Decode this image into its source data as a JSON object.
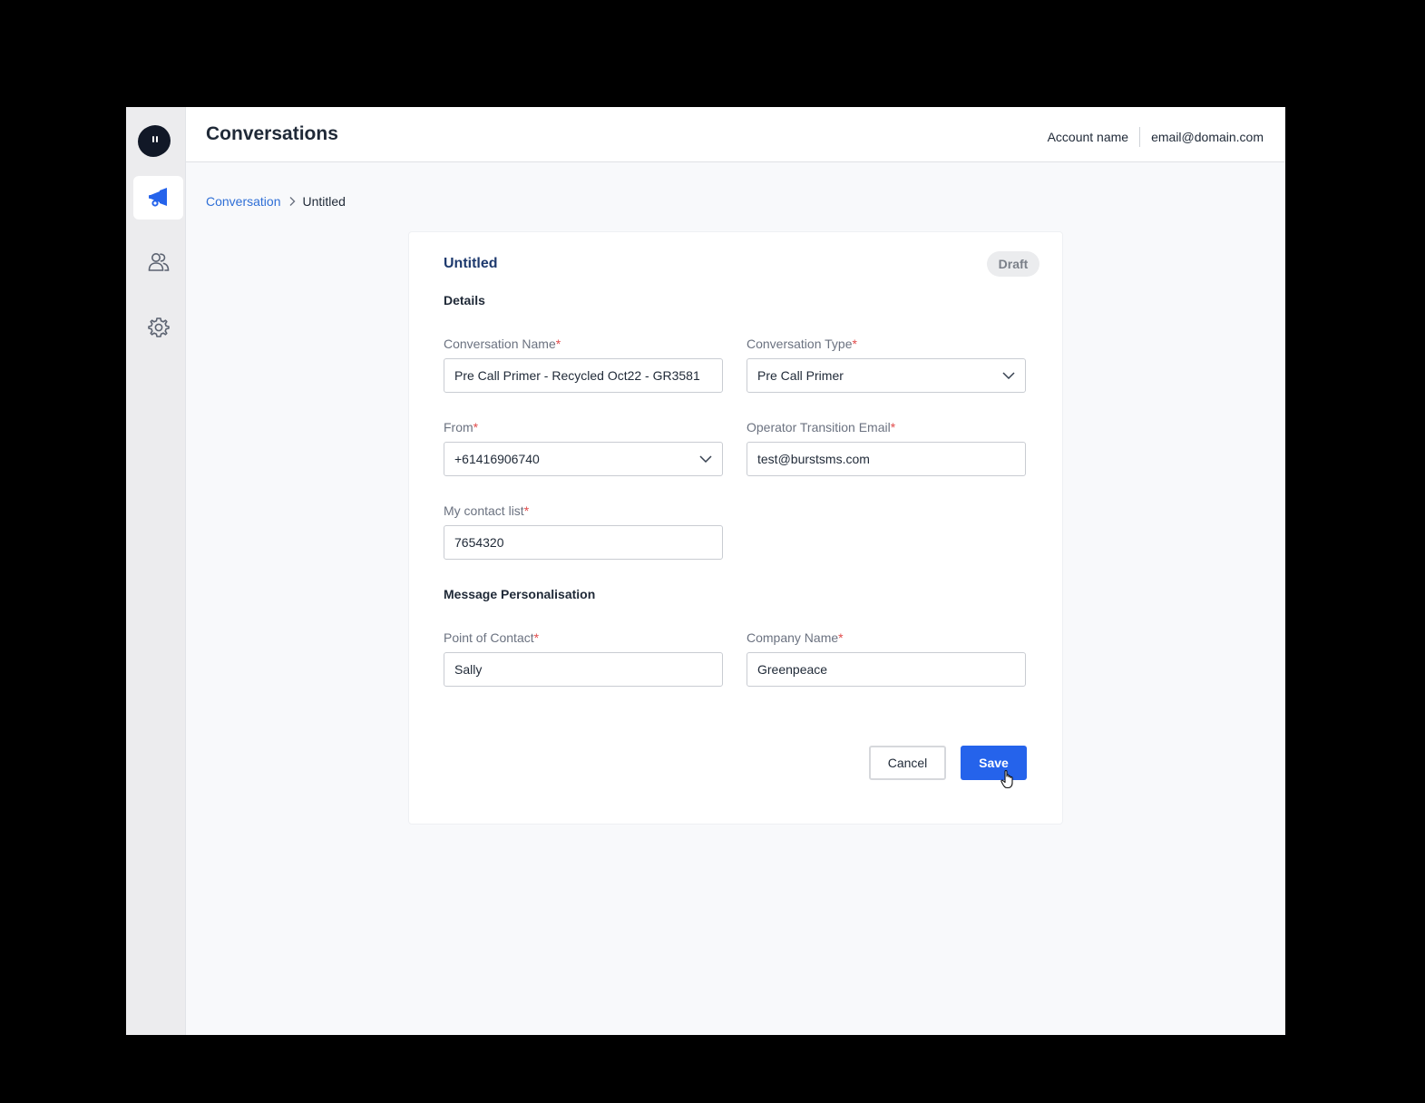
{
  "header": {
    "title": "Conversations",
    "account_name": "Account name",
    "email": "email@domain.com"
  },
  "sidebar": {
    "items": [
      {
        "icon": "megaphone-icon",
        "active": true
      },
      {
        "icon": "users-icon",
        "active": false
      },
      {
        "icon": "gear-icon",
        "active": false
      }
    ]
  },
  "breadcrumb": {
    "parent": "Conversation",
    "current": "Untitled"
  },
  "card": {
    "title": "Untitled",
    "status": "Draft",
    "sections": {
      "details": "Details",
      "personalisation": "Message Personalisation"
    },
    "fields": {
      "conversation_name": {
        "label": "Conversation Name",
        "value": "Pre Call Primer - Recycled Oct22 - GR3581"
      },
      "conversation_type": {
        "label": "Conversation Type",
        "value": "Pre Call Primer"
      },
      "from": {
        "label": "From",
        "value": "+61416906740"
      },
      "operator_email": {
        "label": "Operator Transition Email",
        "value": "test@burstsms.com"
      },
      "contact_list": {
        "label": "My contact list",
        "value": "7654320"
      },
      "point_of_contact": {
        "label": "Point of Contact",
        "value": "Sally"
      },
      "company_name": {
        "label": "Company Name",
        "value": "Greenpeace"
      }
    },
    "required_mark": "*",
    "buttons": {
      "cancel": "Cancel",
      "save": "Save"
    }
  },
  "colors": {
    "primary": "#2563eb",
    "link": "#2f6fd6",
    "title": "#1e3a6e",
    "required": "#e14b4b"
  }
}
